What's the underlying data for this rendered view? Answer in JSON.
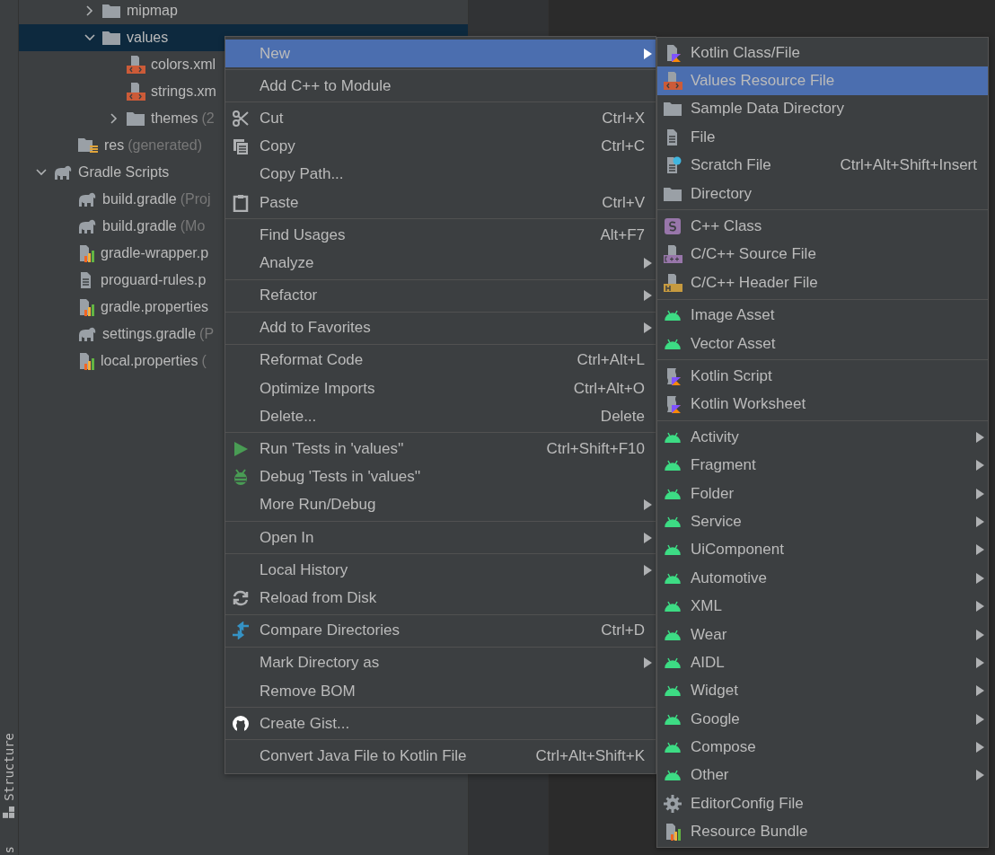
{
  "tool_strip": {
    "buttons": [
      "Structure",
      "s"
    ]
  },
  "project_tree": {
    "items": [
      {
        "children": [
          {
            "children": [
              {
                "name": "mipmap",
                "kind": "folder",
                "expanded": false,
                "selected": false
              },
              {
                "name": "values",
                "kind": "folder",
                "expanded": true,
                "selected": true,
                "children": [
                  {
                    "name": "colors.xml",
                    "kind": "xml-file",
                    "selected": false
                  },
                  {
                    "name": "strings.xm",
                    "kind": "xml-file",
                    "selected": false
                  },
                  {
                    "name": "themes",
                    "note": "(2",
                    "kind": "folder",
                    "expanded": false,
                    "selected": false
                  }
                ]
              }
            ]
          },
          {
            "name": "res",
            "note": "(generated)",
            "kind": "generated-folder",
            "selected": false
          }
        ]
      },
      {
        "name": "Gradle Scripts",
        "kind": "gradle",
        "expanded": true,
        "selected": false,
        "children": [
          {
            "name": "build.gradle",
            "note": "(Proj",
            "kind": "gradle",
            "selected": false
          },
          {
            "name": "build.gradle",
            "note": "(Mo",
            "kind": "gradle",
            "selected": false
          },
          {
            "name": "gradle-wrapper.p",
            "kind": "properties",
            "selected": false
          },
          {
            "name": "proguard-rules.p",
            "kind": "text",
            "selected": false
          },
          {
            "name": "gradle.properties",
            "kind": "properties",
            "selected": false
          },
          {
            "name": "settings.gradle",
            "note": "(P",
            "kind": "gradle",
            "selected": false
          },
          {
            "name": "local.properties",
            "note": "(",
            "kind": "properties",
            "selected": false
          }
        ]
      }
    ]
  },
  "context_menu": {
    "groups": [
      [
        {
          "label": "New",
          "submenu": true,
          "selected": true
        }
      ],
      [
        {
          "label": "Add C++ to Module",
          "submenu": false,
          "selected": false
        }
      ],
      [
        {
          "label": "Cut",
          "shortcut": "Ctrl+X",
          "submenu": false,
          "selected": false
        },
        {
          "label": "Copy",
          "shortcut": "Ctrl+C",
          "submenu": false,
          "selected": false
        },
        {
          "label": "Copy Path...",
          "submenu": false,
          "selected": false
        },
        {
          "label": "Paste",
          "shortcut": "Ctrl+V",
          "submenu": false,
          "selected": false
        }
      ],
      [
        {
          "label": "Find Usages",
          "shortcut": "Alt+F7",
          "submenu": false,
          "selected": false
        },
        {
          "label": "Analyze",
          "submenu": true,
          "selected": false
        }
      ],
      [
        {
          "label": "Refactor",
          "submenu": true,
          "selected": false
        }
      ],
      [
        {
          "label": "Add to Favorites",
          "submenu": true,
          "selected": false
        }
      ],
      [
        {
          "label": "Reformat Code",
          "shortcut": "Ctrl+Alt+L",
          "submenu": false,
          "selected": false
        },
        {
          "label": "Optimize Imports",
          "shortcut": "Ctrl+Alt+O",
          "submenu": false,
          "selected": false
        },
        {
          "label": "Delete...",
          "shortcut": "Delete",
          "submenu": false,
          "selected": false
        }
      ],
      [
        {
          "label": "Run 'Tests in 'values''",
          "shortcut": "Ctrl+Shift+F10",
          "submenu": false,
          "selected": false
        },
        {
          "label": "Debug 'Tests in 'values''",
          "submenu": false,
          "selected": false
        },
        {
          "label": "More Run/Debug",
          "submenu": true,
          "selected": false
        }
      ],
      [
        {
          "label": "Open In",
          "submenu": true,
          "selected": false
        }
      ],
      [
        {
          "label": "Local History",
          "submenu": true,
          "selected": false
        },
        {
          "label": "Reload from Disk",
          "submenu": false,
          "selected": false
        }
      ],
      [
        {
          "label": "Compare Directories",
          "shortcut": "Ctrl+D",
          "submenu": false,
          "selected": false
        }
      ],
      [
        {
          "label": "Mark Directory as",
          "submenu": true,
          "selected": false
        },
        {
          "label": "Remove BOM",
          "submenu": false,
          "selected": false
        }
      ],
      [
        {
          "label": "Create Gist...",
          "submenu": false,
          "selected": false
        }
      ],
      [
        {
          "label": "Convert Java File to Kotlin File",
          "shortcut": "Ctrl+Alt+Shift+K",
          "submenu": false,
          "selected": false
        }
      ]
    ]
  },
  "new_submenu": {
    "groups": [
      [
        {
          "label": "Kotlin Class/File",
          "submenu": false,
          "selected": false
        },
        {
          "label": "Values Resource File",
          "submenu": false,
          "selected": true
        },
        {
          "label": "Sample Data Directory",
          "submenu": false,
          "selected": false
        },
        {
          "label": "File",
          "submenu": false,
          "selected": false
        },
        {
          "label": "Scratch File",
          "shortcut": "Ctrl+Alt+Shift+Insert",
          "submenu": false,
          "selected": false
        },
        {
          "label": "Directory",
          "submenu": false,
          "selected": false
        }
      ],
      [
        {
          "label": "C++ Class",
          "submenu": false,
          "selected": false
        },
        {
          "label": "C/C++ Source File",
          "submenu": false,
          "selected": false
        },
        {
          "label": "C/C++ Header File",
          "submenu": false,
          "selected": false
        }
      ],
      [
        {
          "label": "Image Asset",
          "submenu": false,
          "selected": false
        },
        {
          "label": "Vector Asset",
          "submenu": false,
          "selected": false
        }
      ],
      [
        {
          "label": "Kotlin Script",
          "submenu": false,
          "selected": false
        },
        {
          "label": "Kotlin Worksheet",
          "submenu": false,
          "selected": false
        }
      ],
      [
        {
          "label": "Activity",
          "submenu": true,
          "selected": false
        },
        {
          "label": "Fragment",
          "submenu": true,
          "selected": false
        },
        {
          "label": "Folder",
          "submenu": true,
          "selected": false
        },
        {
          "label": "Service",
          "submenu": true,
          "selected": false
        },
        {
          "label": "UiComponent",
          "submenu": true,
          "selected": false
        },
        {
          "label": "Automotive",
          "submenu": true,
          "selected": false
        },
        {
          "label": "XML",
          "submenu": true,
          "selected": false
        },
        {
          "label": "Wear",
          "submenu": true,
          "selected": false
        },
        {
          "label": "AIDL",
          "submenu": true,
          "selected": false
        },
        {
          "label": "Widget",
          "submenu": true,
          "selected": false
        },
        {
          "label": "Google",
          "submenu": true,
          "selected": false
        },
        {
          "label": "Compose",
          "submenu": true,
          "selected": false
        },
        {
          "label": "Other",
          "submenu": true,
          "selected": false
        },
        {
          "label": "EditorConfig File",
          "submenu": false,
          "selected": false
        },
        {
          "label": "Resource Bundle",
          "submenu": false,
          "selected": false
        }
      ]
    ]
  }
}
